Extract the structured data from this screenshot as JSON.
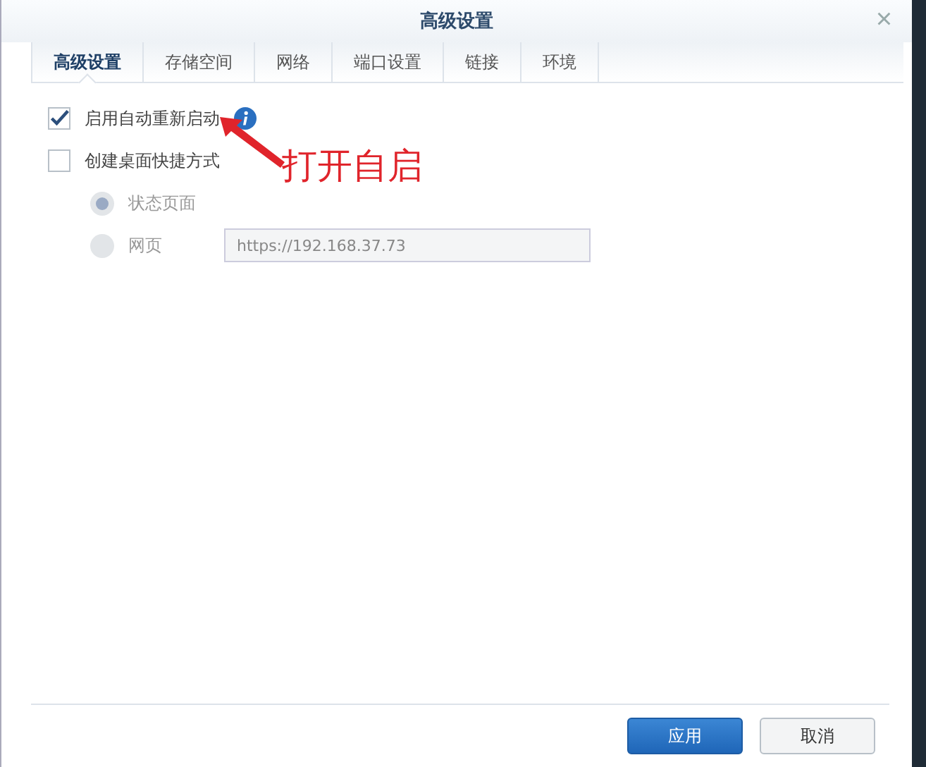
{
  "window": {
    "title": "高级设置",
    "close": "×"
  },
  "tabs": [
    {
      "label": "高级设置",
      "selected": true
    },
    {
      "label": "存储空间",
      "selected": false
    },
    {
      "label": "网络",
      "selected": false
    },
    {
      "label": "端口设置",
      "selected": false
    },
    {
      "label": "链接",
      "selected": false
    },
    {
      "label": "环境",
      "selected": false
    }
  ],
  "options": [
    {
      "kind": "checkbox",
      "label": "启用自动重新启动",
      "checked": true,
      "info": true
    },
    {
      "kind": "checkbox",
      "label": "创建桌面快捷方式",
      "checked": false,
      "info": false
    },
    {
      "kind": "radio",
      "label": "状态页面",
      "selected": true,
      "disabled": true
    },
    {
      "kind": "radio",
      "label": "网页",
      "selected": false,
      "disabled": true,
      "value": "https://192.168.37.73"
    }
  ],
  "annotation": {
    "text": "打开自启"
  },
  "buttons": [
    {
      "label": "应用",
      "primary": true
    },
    {
      "label": "取消",
      "primary": false
    }
  ]
}
